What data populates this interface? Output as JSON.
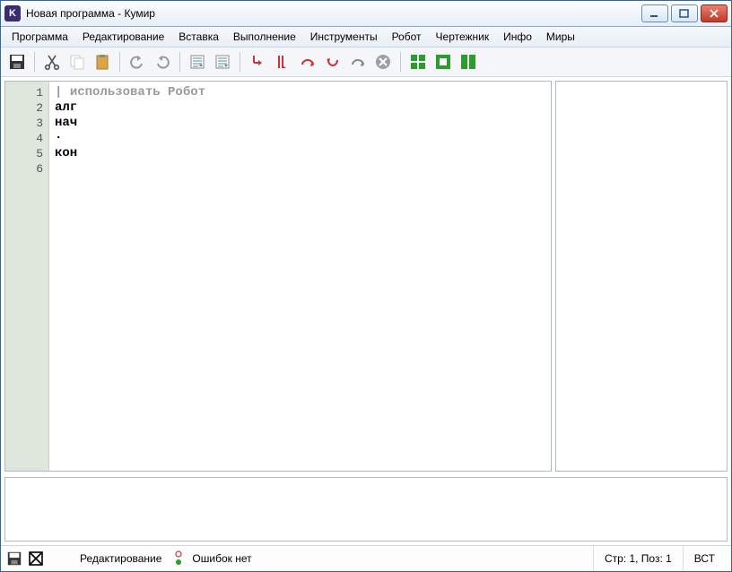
{
  "window": {
    "title": "Новая программа - Кумир"
  },
  "menu": {
    "items": [
      "Программа",
      "Редактирование",
      "Вставка",
      "Выполнение",
      "Инструменты",
      "Робот",
      "Чертежник",
      "Инфо",
      "Миры"
    ]
  },
  "editor": {
    "gutter": [
      "1",
      "2",
      "3",
      "4",
      "5",
      "6"
    ],
    "lines": {
      "comment": "использовать Робот",
      "l2": "алг",
      "l3": "нач",
      "l4": "·",
      "l5": "кон",
      "l6": ""
    }
  },
  "status": {
    "mode": "Редактирование",
    "errors": "Ошибок нет",
    "cursor_pos": "Стр: 1, Поз: 1",
    "insert_mode": "ВСТ"
  }
}
